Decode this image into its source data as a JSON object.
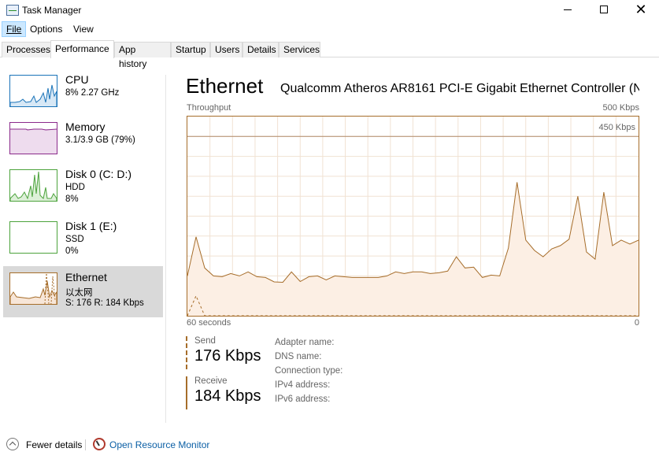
{
  "window": {
    "title": "Task Manager"
  },
  "menu": {
    "file": "File",
    "options": "Options",
    "view": "View"
  },
  "tabs": [
    {
      "label": "Processes",
      "active": false
    },
    {
      "label": "Performance",
      "active": true
    },
    {
      "label": "App history",
      "active": false
    },
    {
      "label": "Startup",
      "active": false
    },
    {
      "label": "Users",
      "active": false
    },
    {
      "label": "Details",
      "active": false
    },
    {
      "label": "Services",
      "active": false
    }
  ],
  "resources": [
    {
      "name": "CPU",
      "line1": "8%  2.27 GHz",
      "line2": "",
      "line3": "",
      "color": "#1a73b8"
    },
    {
      "name": "Memory",
      "line1": "3.1/3.9 GB (79%)",
      "line2": "",
      "line3": "",
      "color": "#8b2a8b"
    },
    {
      "name": "Disk 0 (C: D:)",
      "line1": "HDD",
      "line2": "8%",
      "line3": "",
      "color": "#4ca33c"
    },
    {
      "name": "Disk 1 (E:)",
      "line1": "SSD",
      "line2": "0%",
      "line3": "",
      "color": "#4ca33c"
    },
    {
      "name": "Ethernet",
      "line1": "以太网",
      "line2": "S: 176  R: 184 Kbps",
      "line3": "",
      "color": "#a66d2a"
    }
  ],
  "main": {
    "title": "Ethernet",
    "subtitle": "Qualcomm Atheros AR8161 PCI-E Gigabit Ethernet Controller (N...",
    "graph_label": "Throughput",
    "graph_max": "500 Kbps",
    "graph_scale": "450 Kbps",
    "axis_left": "60 seconds",
    "axis_right": "0",
    "send_label": "Send",
    "send_value": "176 Kbps",
    "receive_label": "Receive",
    "receive_value": "184 Kbps",
    "properties": [
      "Adapter name:",
      "DNS name:",
      "Connection type:",
      "IPv4 address:",
      "IPv6 address:"
    ]
  },
  "footer": {
    "fewer_details": "Fewer details",
    "resource_monitor": "Open Resource Monitor"
  },
  "colors": {
    "accent": "#a66d2a",
    "selected_bg": "#d9d9d9",
    "link": "#0b5fa5"
  },
  "chart_data": {
    "type": "line",
    "xlabel": "",
    "ylabel": "",
    "xlim": [
      60,
      0
    ],
    "ylim": [
      0,
      500
    ],
    "series": [
      {
        "style": "solid",
        "values": [
          100,
          198,
          120,
          100,
          98,
          106,
          100,
          110,
          98,
          96,
          85,
          84,
          110,
          86,
          98,
          100,
          90,
          100,
          98,
          96,
          96,
          96,
          96,
          100,
          110,
          106,
          110,
          110,
          106,
          108,
          112,
          148,
          120,
          122,
          96,
          102,
          100,
          170,
          335,
          190,
          164,
          148,
          168,
          176,
          192,
          300,
          160,
          142,
          310,
          176,
          190,
          180,
          190
        ]
      },
      {
        "style": "dashed",
        "values": [
          0,
          50,
          0,
          0,
          0,
          0,
          0,
          0,
          0,
          0,
          0,
          0,
          0,
          0,
          0,
          0,
          0,
          0,
          0,
          0,
          0,
          0,
          0,
          0,
          0,
          0,
          0,
          0,
          0,
          0,
          0,
          0,
          0,
          0,
          0,
          0,
          0,
          0,
          0,
          0,
          0,
          0,
          0,
          0,
          0,
          0,
          0,
          0,
          0,
          0,
          0,
          0,
          0
        ]
      }
    ]
  }
}
